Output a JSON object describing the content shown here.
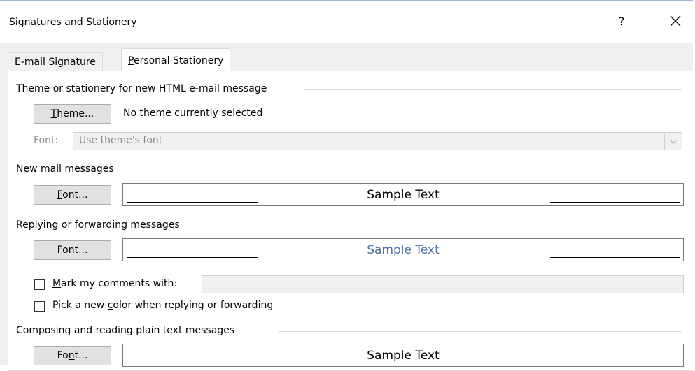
{
  "window": {
    "title": "Signatures and Stationery",
    "help_label": "?",
    "close_icon": "close-icon"
  },
  "tabs": [
    {
      "label_pre": "",
      "label_underlined": "E",
      "label_post": "-mail Signature",
      "active": false
    },
    {
      "label_pre": "",
      "label_underlined": "P",
      "label_post": "ersonal Stationery",
      "active": true
    }
  ],
  "theme_section": {
    "heading": "Theme or stationery for new HTML e-mail message",
    "theme_button": {
      "pre": "",
      "underlined": "T",
      "post": "heme..."
    },
    "theme_status": "No theme currently selected",
    "font_label": "Font:",
    "font_value": "Use theme's font"
  },
  "new_mail": {
    "heading": "New mail messages",
    "font_button": {
      "pre": "",
      "underlined": "F",
      "post": "ont..."
    },
    "sample_text": "Sample Text",
    "sample_color": "#000000"
  },
  "replying": {
    "heading": "Replying or forwarding messages",
    "font_button": {
      "pre": "F",
      "underlined": "o",
      "post": "nt..."
    },
    "sample_text": "Sample Text",
    "sample_color": "#4a6fa5",
    "mark_comments": {
      "pre": "",
      "underlined": "M",
      "post": "ark my comments with:",
      "checked": false,
      "value": ""
    },
    "pick_color": {
      "pre": "Pick a new ",
      "underlined": "c",
      "post": "olor when replying or forwarding",
      "checked": false
    }
  },
  "plain_text": {
    "heading": "Composing and reading plain text messages",
    "font_button": {
      "pre": "Fo",
      "underlined": "n",
      "post": "t..."
    },
    "sample_text": "Sample Text",
    "sample_color": "#000000"
  }
}
